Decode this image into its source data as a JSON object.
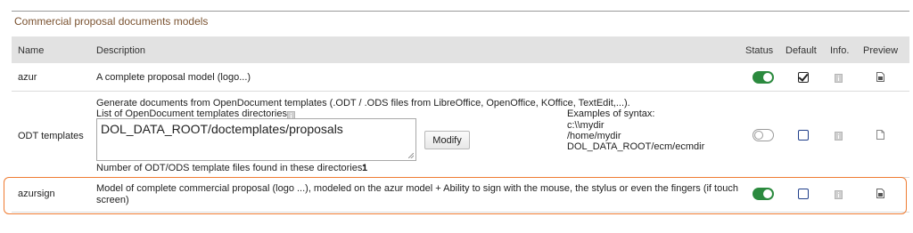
{
  "section_title": "Commercial proposal documents models",
  "columns": {
    "name": "Name",
    "description": "Description",
    "status": "Status",
    "default": "Default",
    "info": "Info.",
    "preview": "Preview"
  },
  "rows": [
    {
      "name": "azur",
      "description": "A complete proposal model (logo...)",
      "status": "on",
      "default": true
    },
    {
      "name": "ODT templates",
      "description_line1": "Generate documents from OpenDocument templates (.ODT / .ODS files from LibreOffice, OpenOffice, KOffice, TextEdit,...).",
      "dirs_label": "List of OpenDocument templates directories",
      "dirs_value": "DOL_DATA_ROOT/doctemplates/proposals",
      "modify_label": "Modify",
      "examples_title": "Examples of syntax:",
      "examples": [
        "c:\\\\mydir",
        "/home/mydir",
        "DOL_DATA_ROOT/ecm/ecmdir"
      ],
      "found_label": "Number of ODT/ODS template files found in these directories:",
      "found_count": "1",
      "status": "off",
      "default": false
    },
    {
      "name": "azursign",
      "description_line1": "Model of complete commercial proposal (logo ...), modeled on the azur model + Ability to sign with the mouse, the stylus or even the fingers (if touch",
      "description_line2": "screen)",
      "status": "on",
      "default": false
    }
  ],
  "colors": {
    "section_title": "#7a5230",
    "toggle_on": "#2b8a3e",
    "highlight": "#ef7c32",
    "header_bg": "#e2e2e2"
  },
  "icons": {
    "info": "info-icon",
    "preview": "file-preview-icon"
  }
}
